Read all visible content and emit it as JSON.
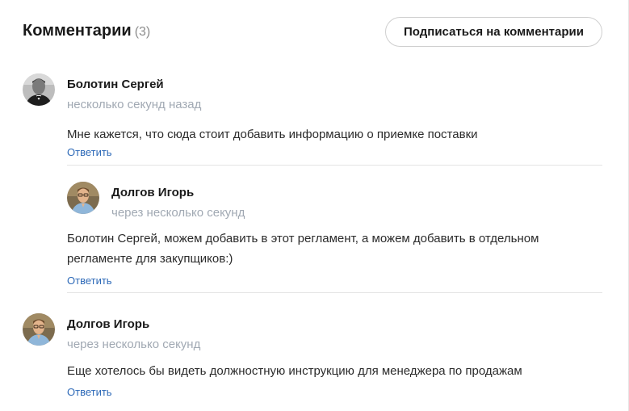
{
  "header": {
    "title": "Комментарии",
    "count": "(3)",
    "subscribe_label": "Подписаться на комментарии"
  },
  "comments": [
    {
      "author": "Болотин Сергей",
      "time": "несколько секунд назад",
      "text": "Мне кажется, что сюда стоит добавить информацию о приемке поставки",
      "reply_label": "Ответить",
      "avatar_icon": "user-photo-icon"
    },
    {
      "author": "Долгов Игорь",
      "time": "через несколько секунд",
      "text": "Болотин Сергей, можем добавить в этот регламент, а можем добавить в отдельном регламенте для закупщиков:)",
      "reply_label": "Ответить",
      "avatar_icon": "user-photo-icon"
    },
    {
      "author": "Долгов Игорь",
      "time": "через несколько секунд",
      "text": "Еще хотелось бы видеть должностную инструкцию для менеджера по продажам",
      "reply_label": "Ответить",
      "avatar_icon": "user-photo-icon"
    }
  ],
  "colors": {
    "link": "#2e6ab8",
    "muted": "#a1a9b3",
    "divider": "#e3e3e3"
  }
}
